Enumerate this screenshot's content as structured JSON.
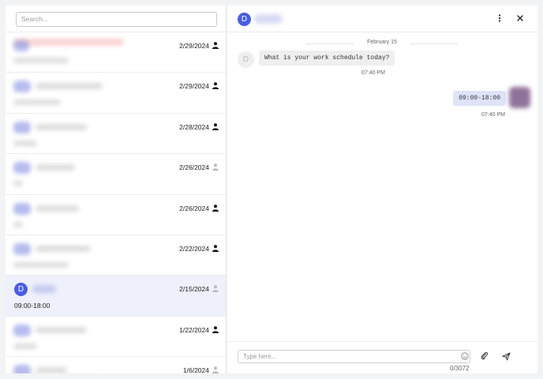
{
  "search": {
    "placeholder": "Search..."
  },
  "conversations": [
    {
      "date": "2/29/2024",
      "preview": "",
      "person_active": true,
      "active": false
    },
    {
      "date": "2/29/2024",
      "preview": "",
      "person_active": true,
      "active": false
    },
    {
      "date": "2/28/2024",
      "preview": "",
      "person_active": true,
      "active": false
    },
    {
      "date": "2/26/2024",
      "preview": "",
      "person_active": false,
      "active": false
    },
    {
      "date": "2/26/2024",
      "preview": "",
      "person_active": true,
      "active": false
    },
    {
      "date": "2/22/2024",
      "preview": "",
      "person_active": true,
      "active": false
    },
    {
      "date": "2/15/2024",
      "preview": "09:00-18:00",
      "avatar": "D",
      "person_active": false,
      "active": true
    },
    {
      "date": "1/22/2024",
      "preview": "",
      "person_active": true,
      "active": false
    },
    {
      "date": "1/6/2024",
      "preview": "",
      "person_active": false,
      "active": false
    }
  ],
  "chat": {
    "avatar": "D",
    "date_divider": "February 15",
    "messages": [
      {
        "direction": "in",
        "avatar": "D",
        "text": "What is your work schedule today?",
        "time": "07:40 PM"
      },
      {
        "direction": "out",
        "text": "09:00-18:00",
        "time": "07:40 PM"
      }
    ]
  },
  "composer": {
    "placeholder": "Type here...",
    "counter": "0/3072"
  },
  "colors": {
    "accent": "#4a5de0",
    "active_row": "#eef0fb",
    "out_bubble": "#dfe3fa"
  },
  "icons": {
    "menu": "more-vertical-icon",
    "close": "close-icon",
    "emoji": "smiley-icon",
    "attach": "paperclip-icon",
    "send": "send-icon",
    "person": "person-icon"
  }
}
